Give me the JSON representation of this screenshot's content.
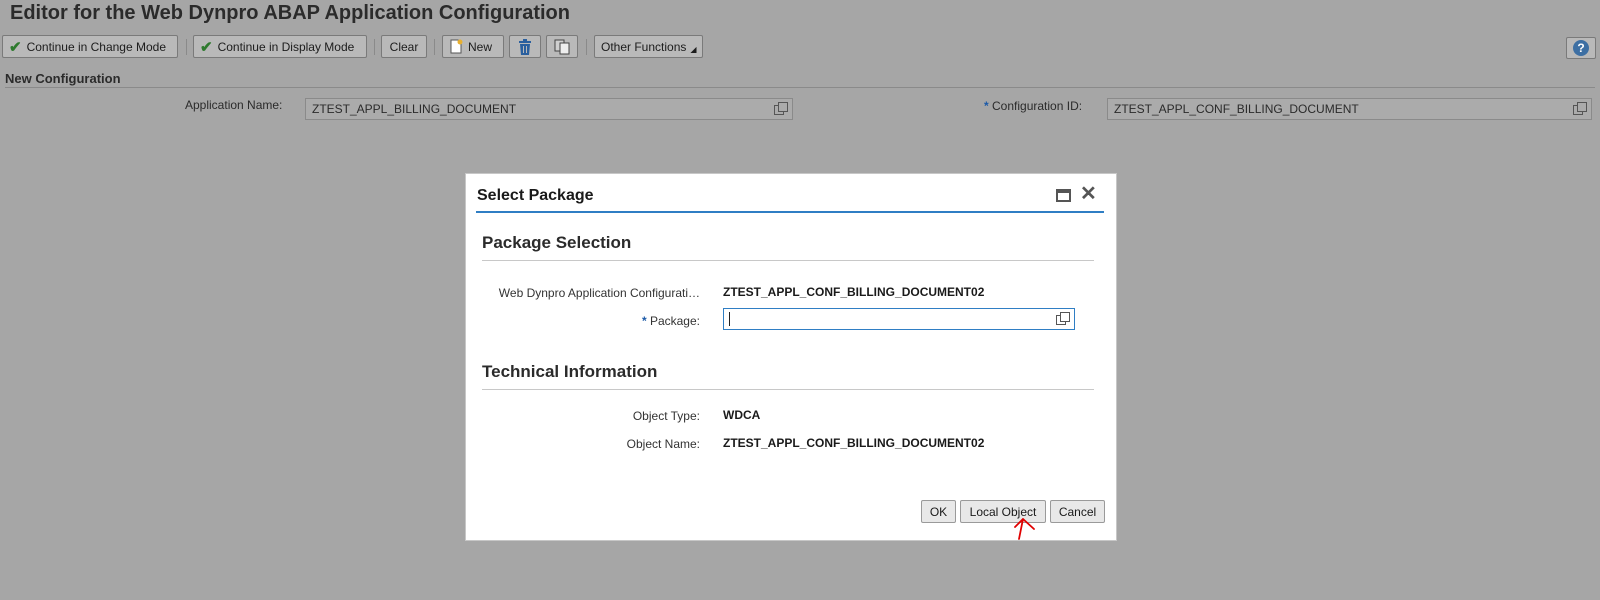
{
  "page": {
    "title": "Editor for the Web Dynpro ABAP Application Configuration"
  },
  "toolbar": {
    "continue_change": "Continue in Change Mode",
    "continue_display": "Continue in Display Mode",
    "clear": "Clear",
    "new": "New",
    "other_functions": "Other Functions",
    "help": "?"
  },
  "section": {
    "title": "New Configuration",
    "app_name_label": "Application Name:",
    "app_name_value": "ZTEST_APPL_BILLING_DOCUMENT",
    "config_id_label": "Configuration ID:",
    "config_id_value": "ZTEST_APPL_CONF_BILLING_DOCUMENT",
    "required_mark": "*"
  },
  "dialog": {
    "title": "Select Package",
    "package_selection": {
      "title": "Package Selection",
      "config_label": "Web Dynpro Application Configurati…",
      "config_value": "ZTEST_APPL_CONF_BILLING_DOCUMENT02",
      "package_label": "Package:",
      "package_value": ""
    },
    "technical_info": {
      "title": "Technical Information",
      "object_type_label": "Object Type:",
      "object_type_value": "WDCA",
      "object_name_label": "Object Name:",
      "object_name_value": "ZTEST_APPL_CONF_BILLING_DOCUMENT02"
    },
    "buttons": {
      "ok": "OK",
      "local_object": "Local Object",
      "cancel": "Cancel"
    }
  },
  "colors": {
    "overlay": "#a6a6a6",
    "accent": "#2f7ec4",
    "required": "#1c5aa8",
    "annotation": "#e00000"
  }
}
